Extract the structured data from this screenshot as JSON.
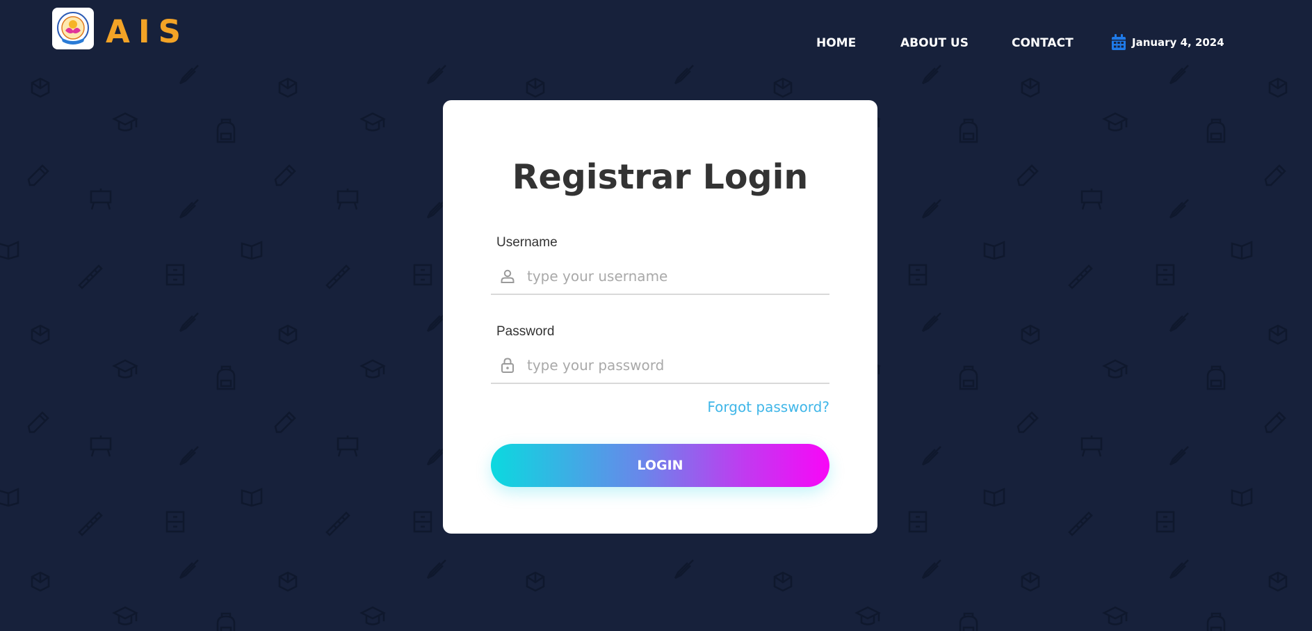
{
  "brand": {
    "name": "AIS",
    "logo_icon": "school-seal-logo-icon",
    "accent_color": "#f3a326"
  },
  "nav": {
    "items": [
      {
        "label": "HOME"
      },
      {
        "label": "ABOUT US"
      },
      {
        "label": "CONTACT"
      }
    ],
    "date": {
      "icon": "calendar-icon",
      "text": "January 4, 2024"
    }
  },
  "login": {
    "title": "Registrar Login",
    "username": {
      "label": "Username",
      "placeholder": "type your username",
      "value": "",
      "icon": "user-icon"
    },
    "password": {
      "label": "Password",
      "placeholder": "type your password",
      "value": "",
      "icon": "lock-icon"
    },
    "forgot_label": "Forgot password?",
    "submit_label": "LOGIN"
  },
  "colors": {
    "background": "#17213b",
    "card": "#ffffff",
    "link": "#3fb6e8",
    "button_gradient_start": "#0bd9df",
    "button_gradient_end": "#f807f7"
  }
}
